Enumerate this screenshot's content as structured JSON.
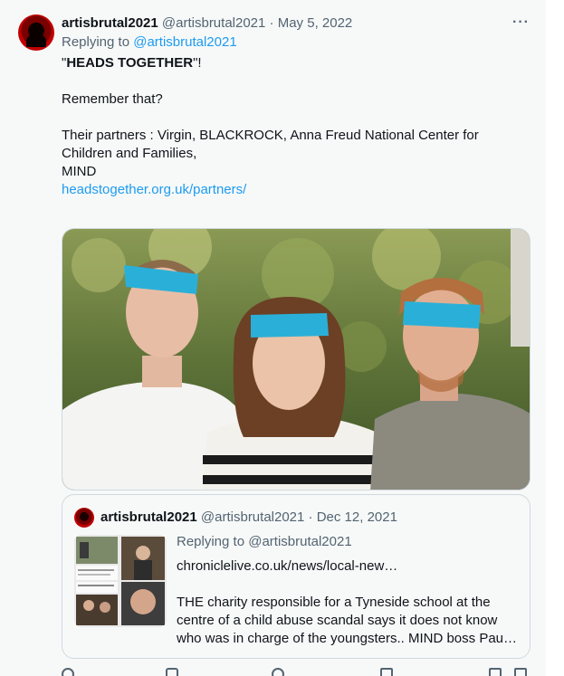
{
  "tweet": {
    "display_name": "artisbrutal2021",
    "handle": "@artisbrutal2021",
    "separator": " · ",
    "date": "May 5, 2022",
    "more_label": "···",
    "replying_prefix": "Replying to ",
    "replying_handle": "@artisbrutal2021",
    "text": {
      "line1_quote_open": "\"",
      "line1_bold": "HEADS TOGETHER",
      "line1_tail": "\"!",
      "line2": "Remember that?",
      "line3": "Their partners : Virgin, BLACKROCK, Anna Freud National Center for Children and Families,",
      "line4": "MIND",
      "link": "headstogether.org.uk/partners/"
    }
  },
  "quoted": {
    "display_name": "artisbrutal2021",
    "handle": "@artisbrutal2021",
    "separator": " · ",
    "date": "Dec 12, 2021",
    "replying": "Replying to @artisbrutal2021",
    "site": "chroniclelive.co.uk/news/local-new…",
    "body": "THE charity responsible for a Tyneside school at the centre of a child abuse scandal says it does not know who was in charge of the youngsters.. MIND boss Pau…"
  },
  "colors": {
    "link": "#1d9bf0",
    "muted": "#536471",
    "text": "#0f1419",
    "border": "#cfd9de",
    "headband": "#2ab0d8"
  },
  "icons": [
    "more-icon",
    "reply-icon",
    "retweet-icon",
    "like-icon",
    "views-icon",
    "bookmark-icon",
    "share-icon"
  ]
}
